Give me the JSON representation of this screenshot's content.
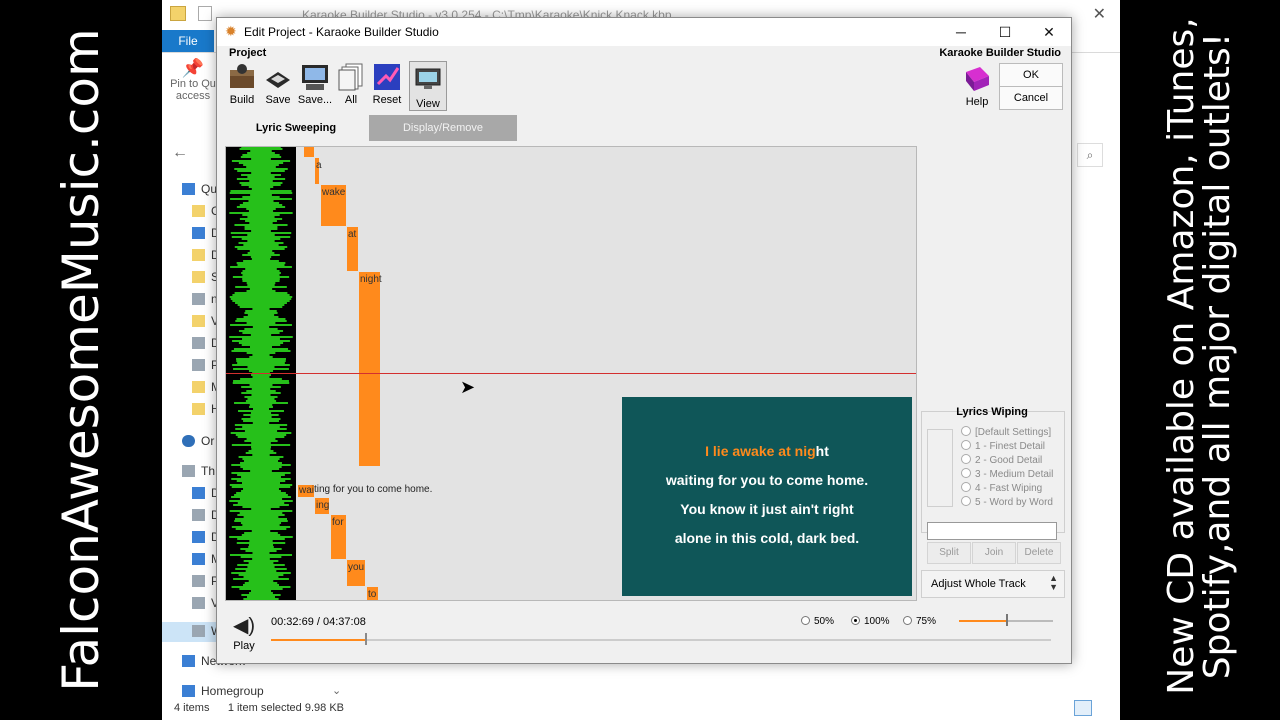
{
  "banners": {
    "left_text": "FalconAwesomeMusic.com",
    "right_line1": "New CD available on Amazon, iTunes,",
    "right_line2": "Spotify,and all major digital outlets!"
  },
  "explorer": {
    "title": "Karaoke Builder Studio - v3.0.254 - C:\\Tmp\\Karaoke\\Knick Knack.kbp",
    "file_tab": "File",
    "pin_label_1": "Pin to Qu",
    "pin_label_2": "access",
    "nav_items": [
      {
        "label": "Qu",
        "icon": "star-icon"
      },
      {
        "label": "C",
        "icon": "folder-icon"
      },
      {
        "label": "D",
        "icon": "download-icon"
      },
      {
        "label": "D",
        "icon": "folder-icon"
      },
      {
        "label": "S",
        "icon": "folder-icon"
      },
      {
        "label": "n",
        "icon": "pc-icon"
      },
      {
        "label": "V",
        "icon": "folder-icon"
      },
      {
        "label": "D",
        "icon": "document-icon"
      },
      {
        "label": "P",
        "icon": "picture-icon"
      },
      {
        "label": "M",
        "icon": "folder-icon"
      },
      {
        "label": "H",
        "icon": "folder-icon"
      },
      {
        "label": "Or",
        "icon": "cloud-icon"
      },
      {
        "label": "Th",
        "icon": "pc-icon"
      },
      {
        "label": "D",
        "icon": "desktop-icon"
      },
      {
        "label": "D",
        "icon": "document-icon"
      },
      {
        "label": "D",
        "icon": "download-icon"
      },
      {
        "label": "M",
        "icon": "music-icon"
      },
      {
        "label": "P",
        "icon": "picture-icon"
      },
      {
        "label": "V",
        "icon": "video-icon"
      },
      {
        "label": "W",
        "icon": "drive-icon"
      },
      {
        "label": "Network",
        "icon": "network-icon"
      },
      {
        "label": "Homegroup",
        "icon": "homegroup-icon"
      }
    ],
    "status_items": "4 items",
    "status_selected": "1 item selected  9.98 KB"
  },
  "dialog": {
    "title": "Edit Project - Karaoke Builder Studio",
    "project_group": "Project",
    "brand": "Karaoke Builder Studio",
    "toolbar": [
      {
        "label": "Build",
        "icon": "build-icon"
      },
      {
        "label": "Save",
        "icon": "save-icon"
      },
      {
        "label": "Save...",
        "icon": "save-as-icon"
      },
      {
        "label": "All",
        "icon": "all-icon"
      },
      {
        "label": "Reset",
        "icon": "reset-icon"
      },
      {
        "label": "View",
        "icon": "view-icon"
      }
    ],
    "help_label": "Help",
    "ok_label": "OK",
    "cancel_label": "Cancel",
    "tabs": {
      "active": "Lyric Sweeping",
      "inactive": "Display/Remove"
    },
    "sweep_blocks": [
      {
        "text": "a"
      },
      {
        "text": "wake"
      },
      {
        "text": "at"
      },
      {
        "text": "night"
      },
      {
        "text": "wai"
      },
      {
        "text": "ing"
      },
      {
        "text": "for"
      },
      {
        "text": "you"
      },
      {
        "text": "to"
      }
    ],
    "phrase_text": "ting for you to come home.",
    "preview": {
      "line1_highlight": "I lie awake at nig",
      "line1_rest": "ht",
      "line2": "waiting for you to come home.",
      "line3": "You know it just ain't right",
      "line4": "alone in this cold, dark bed."
    },
    "lyrics_wiping": {
      "title": "Lyrics Wiping",
      "options": [
        "[Default Settings]",
        "1 - Finest Detail",
        "2 - Good Detail",
        "3 - Medium Detail",
        "4 - Fast Wiping",
        "5 - Word by Word"
      ],
      "buttons": [
        "Split",
        "Join",
        "Delete"
      ],
      "adjust_label": "Adjust Whole Track"
    },
    "player": {
      "play_label": "Play",
      "time": "00:32:69 / 04:37:08",
      "progress_fraction": 0.12,
      "zoom_options": [
        "50%",
        "100%",
        "75%"
      ],
      "zoom_selected": "100%",
      "volume_fraction": 0.5
    },
    "colors": {
      "accent_orange": "#ff8a1c",
      "preview_bg": "#0f5658",
      "wave_green": "#33ff22"
    }
  }
}
